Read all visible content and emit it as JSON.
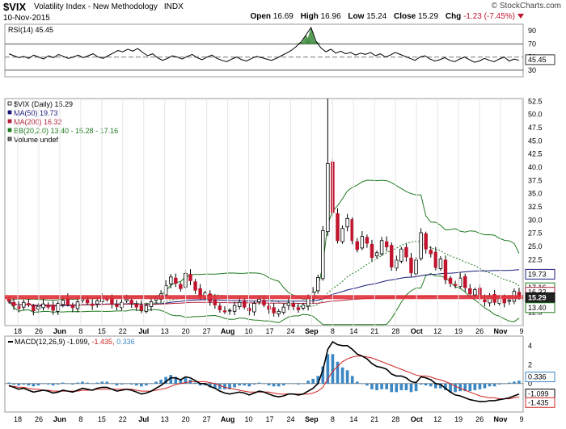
{
  "header": {
    "symbol": "$VIX",
    "name": "Volatility Index - New Methodology",
    "exchange": "INDX",
    "brand": "© StockCharts.com",
    "date": "10-Nov-2015",
    "open_label": "Open",
    "open": "16.69",
    "high_label": "High",
    "high": "16.96",
    "low_label": "Low",
    "low": "15.24",
    "close_label": "Close",
    "close": "15.29",
    "chg_label": "Chg",
    "chg": "-1.23 (-7.45%)"
  },
  "colors": {
    "up": "#ffffff",
    "down": "#c0142f",
    "ma50": "#1a1a7a",
    "ma200": "#b0203a",
    "bb": "#1e7a1e",
    "support": "#e0303a",
    "macd": "#000000",
    "signal": "#d02020",
    "hist": "#3b87c4",
    "rsi_fill": "#3a8a3a"
  },
  "date_labels": [
    "18",
    "26",
    "Jun",
    "8",
    "15",
    "22",
    "Jul",
    "13",
    "20",
    "27",
    "Aug",
    "10",
    "17",
    "24",
    "Sep",
    "8",
    "14",
    "21",
    "28",
    "Oct",
    "12",
    "19",
    "26",
    "Nov",
    "9"
  ],
  "chart_data": [
    {
      "type": "line",
      "name": "rsi-panel",
      "legend": "RSI(14) 45.45",
      "last_value_label": "45.45",
      "ylim": [
        20,
        100
      ],
      "yticks": [
        90,
        70,
        50,
        30
      ],
      "reference_lines": [
        70,
        30
      ],
      "values": [
        55,
        52,
        49,
        51,
        48,
        53,
        50,
        47,
        52,
        49,
        54,
        51,
        48,
        50,
        53,
        49,
        52,
        55,
        50,
        48,
        52,
        56,
        60,
        58,
        62,
        59,
        63,
        57,
        52,
        55,
        49,
        45,
        48,
        52,
        50,
        47,
        51,
        54,
        49,
        46,
        50,
        53,
        48,
        45,
        43,
        47,
        50,
        46,
        44,
        48,
        51,
        49,
        47,
        45,
        48,
        52,
        56,
        60,
        66,
        73,
        84,
        95,
        74,
        64,
        58,
        62,
        56,
        59,
        55,
        57,
        53,
        56,
        54,
        57,
        52,
        55,
        50,
        53,
        57,
        54,
        51,
        48,
        45,
        50,
        52,
        47,
        44,
        46,
        49,
        45,
        43,
        47,
        50,
        46,
        42,
        44,
        48,
        45,
        43,
        47,
        50,
        44,
        47,
        45
      ]
    },
    {
      "type": "candlestick",
      "name": "price-panel",
      "legend": {
        "main": "$VIX (Daily) 15.29",
        "ma50": "MA(50) 19.73",
        "ma200": "MA(200) 16.32",
        "bb": "BB(20,2.0) 13.40 - 15.28 - 17.16",
        "volume": "Volume undef"
      },
      "ylim": [
        10,
        53
      ],
      "yticks": [
        "52.5",
        "50.0",
        "47.5",
        "45.0",
        "42.5",
        "40.0",
        "37.5",
        "35.0",
        "32.5",
        "30.0",
        "27.5",
        "25.0",
        "22.5",
        "20.0",
        "17.5",
        "15.0",
        "12.5"
      ],
      "price_labels": {
        "ma50": "19.73",
        "upper_band": "17.16",
        "ma200": "16.32",
        "close": "15.29",
        "lower_band": "13.40"
      },
      "support_line": 15.4,
      "close": [
        14.6,
        13.8,
        13.2,
        14.4,
        13.9,
        12.8,
        13.6,
        14.1,
        13.5,
        12.9,
        14.2,
        14.8,
        14.0,
        13.4,
        14.5,
        15.1,
        14.3,
        13.8,
        14.7,
        15.3,
        14.9,
        14.1,
        13.6,
        14.4,
        15.0,
        14.2,
        13.5,
        12.9,
        13.8,
        14.5,
        15.2,
        16.0,
        17.6,
        19.2,
        18.0,
        17.0,
        19.9,
        18.5,
        16.7,
        15.4,
        16.2,
        14.6,
        13.9,
        13.0,
        12.6,
        12.9,
        13.8,
        14.4,
        13.5,
        12.8,
        14.2,
        15.0,
        13.9,
        13.1,
        12.4,
        12.7,
        13.5,
        14.3,
        13.6,
        13.0,
        13.9,
        15.2,
        16.3,
        19.1,
        28.0,
        40.7,
        31.4,
        26.1,
        28.4,
        30.3,
        26.1,
        24.4,
        26.9,
        25.6,
        22.9,
        23.8,
        26.1,
        24.9,
        21.1,
        22.4,
        24.5,
        23.0,
        20.0,
        22.4,
        27.6,
        24.5,
        23.6,
        21.0,
        22.6,
        18.7,
        18.0,
        17.6,
        19.0,
        17.2,
        16.0,
        16.8,
        15.1,
        14.5,
        15.6,
        14.4,
        15.4,
        14.3,
        14.8,
        16.5,
        15.3
      ]
    },
    {
      "type": "line",
      "name": "macd-panel",
      "legend": {
        "main": "MACD(12,26,9) -1.099,",
        "signal": "-1.435,",
        "hist": "0.336"
      },
      "ylim": [
        -3,
        5
      ],
      "yticks": [
        "4",
        "2",
        "0",
        "-2"
      ],
      "value_labels": {
        "hist": "0.336",
        "macd": "-1.099",
        "signal": "-1.435"
      },
      "macd": [
        -0.2,
        -0.4,
        -0.6,
        -0.5,
        -0.7,
        -0.9,
        -0.8,
        -0.7,
        -0.8,
        -1.0,
        -0.9,
        -0.7,
        -0.8,
        -0.9,
        -0.7,
        -0.5,
        -0.6,
        -0.7,
        -0.5,
        -0.4,
        -0.4,
        -0.6,
        -0.8,
        -0.7,
        -0.6,
        -0.7,
        -0.9,
        -1.1,
        -1.0,
        -0.8,
        -0.5,
        -0.2,
        0.2,
        0.6,
        0.6,
        0.4,
        0.7,
        0.6,
        0.3,
        0.0,
        0.0,
        -0.3,
        -0.5,
        -0.8,
        -1.0,
        -1.1,
        -1.0,
        -0.9,
        -1.0,
        -1.2,
        -1.0,
        -0.8,
        -0.9,
        -1.1,
        -1.3,
        -1.4,
        -1.3,
        -1.1,
        -1.1,
        -1.2,
        -1.1,
        -0.8,
        -0.5,
        0.0,
        1.4,
        3.6,
        4.4,
        4.1,
        4.0,
        4.0,
        3.6,
        3.1,
        2.9,
        2.6,
        2.1,
        1.8,
        1.7,
        1.5,
        1.0,
        0.8,
        0.8,
        0.6,
        0.2,
        0.1,
        0.7,
        0.6,
        0.4,
        0.0,
        -0.1,
        -0.5,
        -0.9,
        -1.2,
        -1.3,
        -1.5,
        -1.7,
        -1.8,
        -1.9,
        -1.9,
        -1.8,
        -1.8,
        -1.7,
        -1.6,
        -1.5,
        -1.3,
        -1.1
      ],
      "signal": [
        -0.3,
        -0.3,
        -0.4,
        -0.4,
        -0.5,
        -0.6,
        -0.6,
        -0.7,
        -0.7,
        -0.8,
        -0.8,
        -0.8,
        -0.8,
        -0.8,
        -0.8,
        -0.7,
        -0.7,
        -0.7,
        -0.6,
        -0.6,
        -0.6,
        -0.6,
        -0.6,
        -0.6,
        -0.6,
        -0.6,
        -0.7,
        -0.8,
        -0.8,
        -0.8,
        -0.7,
        -0.6,
        -0.5,
        -0.3,
        -0.1,
        0.0,
        0.1,
        0.2,
        0.2,
        0.2,
        0.2,
        0.1,
        0.0,
        -0.2,
        -0.4,
        -0.5,
        -0.6,
        -0.7,
        -0.8,
        -0.9,
        -0.9,
        -0.9,
        -0.9,
        -0.9,
        -1.0,
        -1.1,
        -1.1,
        -1.1,
        -1.1,
        -1.1,
        -1.1,
        -1.1,
        -1.0,
        -0.8,
        -0.4,
        0.5,
        1.3,
        1.8,
        2.3,
        2.6,
        2.8,
        2.9,
        2.9,
        2.8,
        2.7,
        2.5,
        2.3,
        2.1,
        1.9,
        1.7,
        1.5,
        1.3,
        1.1,
        0.9,
        0.8,
        0.8,
        0.7,
        0.5,
        0.4,
        0.2,
        0.0,
        -0.3,
        -0.5,
        -0.7,
        -0.9,
        -1.1,
        -1.3,
        -1.4,
        -1.5,
        -1.5,
        -1.6,
        -1.6,
        -1.6,
        -1.5,
        -1.4
      ]
    }
  ]
}
